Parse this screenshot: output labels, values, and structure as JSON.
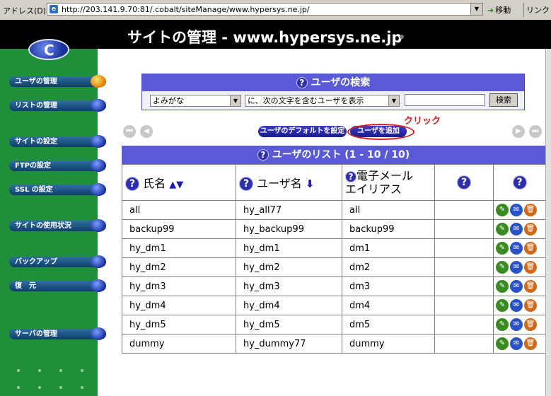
{
  "browser": {
    "address_label": "アドレス(D)",
    "url": "http://203.141.9.70:81/.cobalt/siteManage/www.hypersys.ne.jp/",
    "go_label": "移動",
    "links_label": "リンク"
  },
  "header": {
    "title": "サイトの管理 - www.hypersys.ne.jp"
  },
  "sidebar": {
    "items": [
      {
        "label": "ユーザの管理",
        "active": true
      },
      {
        "label": "リストの管理"
      },
      {
        "label": "サイトの設定"
      },
      {
        "label": "FTPの設定"
      },
      {
        "label": "SSL の設定"
      },
      {
        "label": "サイトの使用状況"
      },
      {
        "label": "バックアップ"
      },
      {
        "label": "復　元"
      },
      {
        "label": "サーバの管理"
      }
    ]
  },
  "search": {
    "title": "ユーザの検索",
    "field_select": "よみがな",
    "condition_select": "に、次の文字を含むユーザを表示",
    "query_value": "",
    "button_label": "検索"
  },
  "actions": {
    "defaults_button": "ユーザのデフォルトを設定",
    "add_button": "ユーザを追加",
    "annotation": "クリック"
  },
  "list": {
    "title": "ユーザのリスト (1 - 10 / 10)",
    "columns": {
      "name": "氏名",
      "username": "ユーザ名",
      "alias_line1": "電子メール",
      "alias_line2": "エイリアス"
    },
    "rows": [
      {
        "name": "all",
        "username": "hy_all77",
        "alias": "all"
      },
      {
        "name": "backup99",
        "username": "hy_backup99",
        "alias": "backup99"
      },
      {
        "name": "hy_dm1",
        "username": "hy_dm1",
        "alias": "dm1"
      },
      {
        "name": "hy_dm2",
        "username": "hy_dm2",
        "alias": "dm2"
      },
      {
        "name": "hy_dm3",
        "username": "hy_dm3",
        "alias": "dm3"
      },
      {
        "name": "hy_dm4",
        "username": "hy_dm4",
        "alias": "dm4"
      },
      {
        "name": "hy_dm5",
        "username": "hy_dm5",
        "alias": "dm5"
      },
      {
        "name": "dummy",
        "username": "hy_dummy77",
        "alias": "dummy"
      }
    ]
  },
  "colors": {
    "sidebar": "#1f8f3a",
    "panel_header": "#5a5ad6",
    "annotation": "#e01a1a"
  }
}
